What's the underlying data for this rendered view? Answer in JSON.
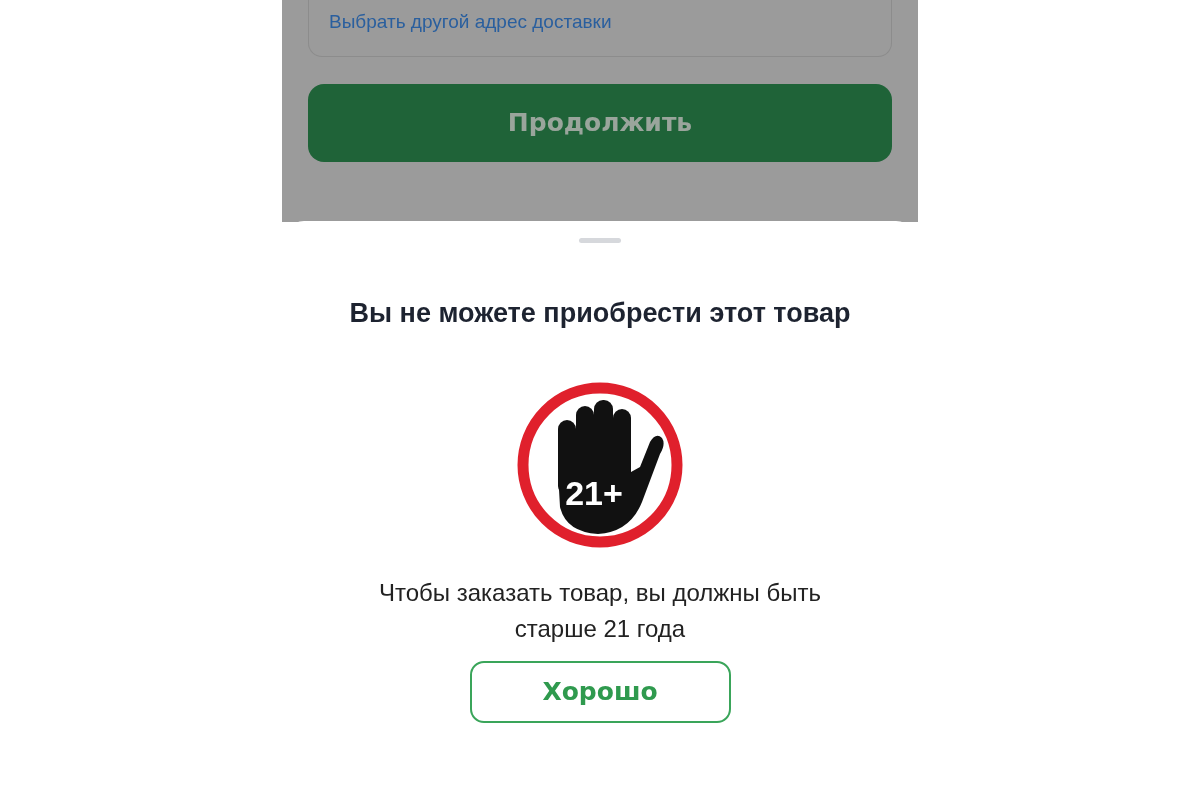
{
  "background_screen": {
    "address_card": {
      "link": "Выбрать другой адрес доставки"
    },
    "continue_button": {
      "label": "Продолжить",
      "disabled": true
    }
  },
  "sheet": {
    "title": "Вы не можете приобрести этот товар",
    "age_badge": "21+",
    "message": "Чтобы заказать товар, вы должны быть старше 21 года",
    "ok_button": "Хорошо"
  }
}
